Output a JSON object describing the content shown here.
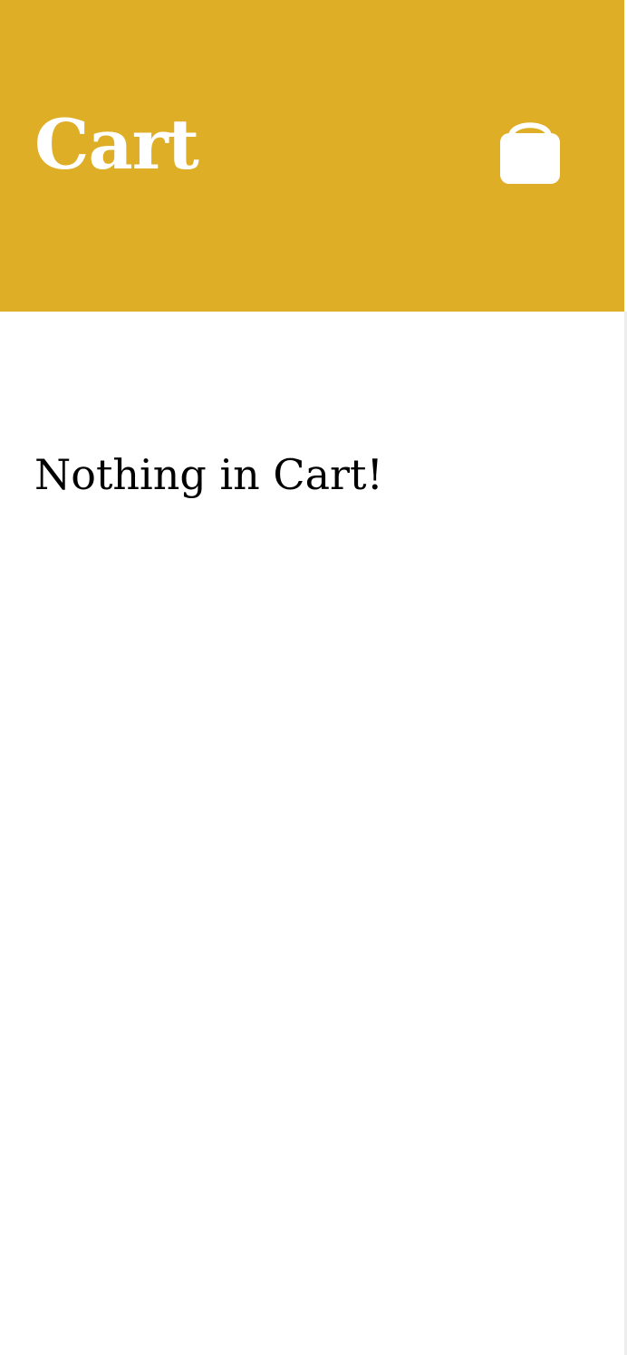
{
  "header": {
    "title": "Cart",
    "background_color": "#ddae26",
    "cart_icon": "shopping-bag-icon"
  },
  "main": {
    "empty_message": "Nothing in Cart!"
  }
}
